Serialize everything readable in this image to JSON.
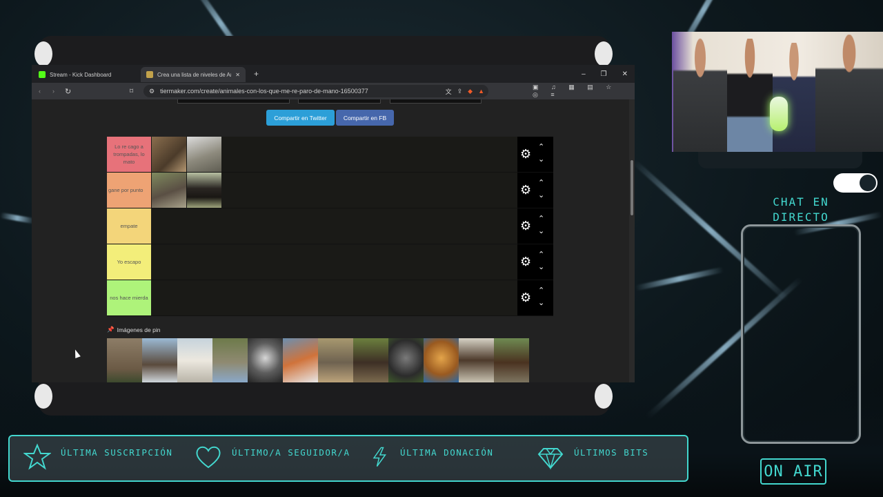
{
  "browser": {
    "tabs": [
      {
        "label": "Stream - Kick Dashboard",
        "icon": "kick-icon",
        "color": "#53fc18"
      },
      {
        "label": "Crea una lista de niveles de Anim",
        "icon": "tiermaker-icon",
        "color": "#c2a24b"
      }
    ],
    "url": "tiermaker.com/create/animales-con-los-que-me-re-paro-de-mano-16500377"
  },
  "page": {
    "share_twitter": "Compartir en Twitter",
    "share_fb": "Compartir en FB",
    "tiers": [
      {
        "label": "Lo re cago a trompadas, lo mato",
        "color": "#e7727a"
      },
      {
        "label": "gane por punto",
        "color": "#eea374"
      },
      {
        "label": "empate",
        "color": "#f3d57a"
      },
      {
        "label": "Yo escapo",
        "color": "#f3ee7a"
      },
      {
        "label": "nos hace mierda",
        "color": "#aef37a"
      }
    ],
    "pin_label": "Imágenes de pin"
  },
  "overlay": {
    "chat_title_line1": "CHAT EN",
    "chat_title_line2": "DIRECTO",
    "on_air": "ON AIR",
    "accent": "#43d8cf",
    "bar": [
      {
        "label": "ÚLTIMA SUSCRIPCIÓN",
        "icon": "star-icon"
      },
      {
        "label": "ÚLTIMO/A SEGUIDOR/A",
        "icon": "heart-icon"
      },
      {
        "label": "ÚLTIMA DONACIÓN",
        "icon": "lightning-icon"
      },
      {
        "label": "ÚLTIMOS BITS",
        "icon": "diamond-icon"
      }
    ]
  }
}
